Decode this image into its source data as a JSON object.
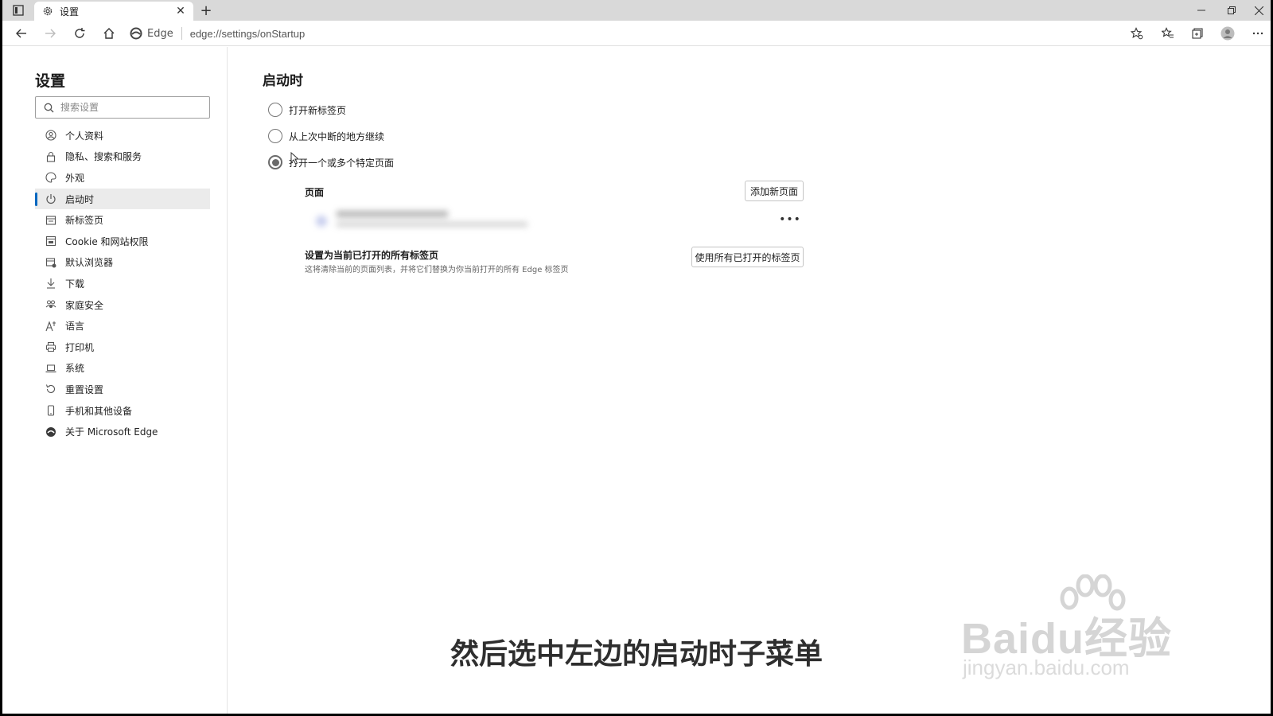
{
  "browser": {
    "tab_title": "设置",
    "site_label": "Edge",
    "url": "edge://settings/onStartup"
  },
  "sidebar": {
    "title": "设置",
    "search_placeholder": "搜索设置",
    "items": [
      {
        "label": "个人资料",
        "icon": "profile-icon"
      },
      {
        "label": "隐私、搜索和服务",
        "icon": "lock-icon"
      },
      {
        "label": "外观",
        "icon": "palette-icon"
      },
      {
        "label": "启动时",
        "icon": "power-icon",
        "active": true
      },
      {
        "label": "新标签页",
        "icon": "new-tab-icon"
      },
      {
        "label": "Cookie 和网站权限",
        "icon": "cookie-icon"
      },
      {
        "label": "默认浏览器",
        "icon": "browser-icon"
      },
      {
        "label": "下载",
        "icon": "download-icon"
      },
      {
        "label": "家庭安全",
        "icon": "family-icon"
      },
      {
        "label": "语言",
        "icon": "language-icon"
      },
      {
        "label": "打印机",
        "icon": "printer-icon"
      },
      {
        "label": "系统",
        "icon": "laptop-icon"
      },
      {
        "label": "重置设置",
        "icon": "reset-icon"
      },
      {
        "label": "手机和其他设备",
        "icon": "phone-icon"
      },
      {
        "label": "关于 Microsoft Edge",
        "icon": "edge-logo-icon"
      }
    ]
  },
  "main": {
    "title": "启动时",
    "options": [
      {
        "label": "打开新标签页",
        "checked": false
      },
      {
        "label": "从上次中断的地方继续",
        "checked": false
      },
      {
        "label": "打开一个或多个特定页面",
        "checked": true
      }
    ],
    "pages_label": "页面",
    "add_page_button": "添加新页面",
    "set_current_title": "设置为当前已打开的所有标签页",
    "set_current_desc": "这将清除当前的页面列表，并将它们替换为你当前打开的所有 Edge 标签页",
    "use_all_tabs_button": "使用所有已打开的标签页"
  },
  "subtitle": "然后选中左边的启动时子菜单",
  "watermark": {
    "brand": "Baidu经验",
    "url": "jingyan.baidu.com"
  },
  "colors": {
    "accent": "#0067c0",
    "titlebar": "#d9d9d9",
    "active_item_bg": "#ebebeb"
  }
}
